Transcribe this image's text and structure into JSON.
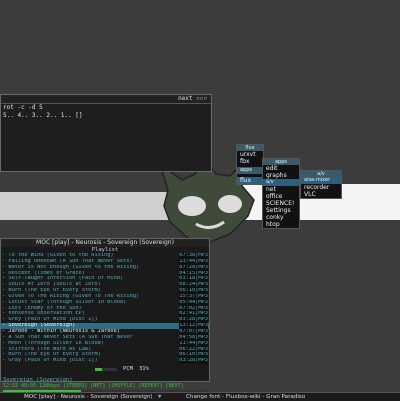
{
  "terminal": {
    "title": "next",
    "prompt_line": "rot -c -d 5",
    "countdown_line": "5.. 4.. 3.. 2.. 1.. []"
  },
  "menus": {
    "flux_title": "flux",
    "flux_items": [
      "urxvt",
      "fbx"
    ],
    "apps_title": "apps",
    "flux_sub_label": "flux",
    "apps_items": [
      "edit",
      "graphs",
      "net",
      "office",
      "SCIENCE!",
      "Settings",
      "conky",
      "htop"
    ],
    "av_title": "a/v",
    "av_items": [
      "alsa-mixer",
      "recorder",
      "VLC"
    ]
  },
  "moc": {
    "title": "MOC [play] - Neurosis - Sovereign (Sovereign)",
    "playlist_label": "Playlist",
    "tracks": [
      {
        "title": "- To the Wind (Given to the Rising)",
        "duration": "07:38",
        "fmt": "MP3"
      },
      {
        "title": "- Falling Unknown (A Sun That Never Sets)",
        "duration": "13:44",
        "fmt": "MP3"
      },
      {
        "title": "- Water is Not Enough (Given to the Rising)",
        "duration": "07:28",
        "fmt": "MP3"
      },
      {
        "title": "- Descent (Times of Grace)",
        "duration": "04:15",
        "fmt": "MP3"
      },
      {
        "title": "- Self-Taught Infection (Pain Of Mind)",
        "duration": "03:18",
        "fmt": "MP3"
      },
      {
        "title": "- Souls At Zero (Souls at Zero)",
        "duration": "08:24",
        "fmt": "MP3"
      },
      {
        "title": "- Burn (The Eye Of Every Storm)",
        "duration": "06:10",
        "fmt": "MP3"
      },
      {
        "title": "- Given To The Rising (Given To The Rising)",
        "duration": "15:37",
        "fmt": "MP3"
      },
      {
        "title": "- Locust Star (Through Silver in Blood)",
        "duration": "05:44",
        "fmt": "MP3"
      },
      {
        "title": "- Lost (Enemy of the Sun)",
        "duration": "07:02",
        "fmt": "MP3"
      },
      {
        "title": "- nonsense Observation EP)",
        "duration": "02:41",
        "fmt": "MP3"
      },
      {
        "title": "- Grey (Pain Of Mind [Disc 1])",
        "duration": "03:28",
        "fmt": "MP3"
      },
      {
        "title": "- Sovereign (Sovereign)",
        "duration": "13:12",
        "fmt": "MP3"
      },
      {
        "title": "- Jarboe - Within (Neurosis & Jarboe)",
        "duration": "07:07",
        "fmt": "MP3"
      },
      {
        "title": "- A Sun That Never Sets (A Sun That Never",
        "duration": "04:58",
        "fmt": "MP3"
      },
      {
        "title": "- Moon (Through Silver in Blood)",
        "duration": "11:44",
        "fmt": "MP3"
      },
      {
        "title": "- Stirtera (The Word As Law)",
        "duration": "06:22",
        "fmt": "MP3"
      },
      {
        "title": "- Burn (The Eye Of Every Storm)",
        "duration": "06:10",
        "fmt": "MP3"
      },
      {
        "title": "- Gray (Pain Of Mind [Disc 1])",
        "duration": "03:28",
        "fmt": "MP3"
      }
    ],
    "volume_label": "PCM",
    "volume_value": "31%",
    "now_playing": "Sovereign (Sovereign)",
    "status_line": "12:52  48:05  128kbps [STEREO]  [NET] [SHUFFLE] [REPEAT]  [NEXT]",
    "progress_fraction": 0.38
  },
  "taskbar": {
    "tasks": [
      "MOC [play] - Neurosis - Sovereign (Sovereign)",
      "Change font - Fluxbox-wiki - Gran Paradiso"
    ]
  },
  "colors": {
    "desktop": "#3c3c3c",
    "accent_cyan": "#4fb0c0",
    "highlight_row": "#2e6d86",
    "progress_green": "#3bbf3b",
    "logo_green": "#3f4a3a"
  },
  "icons": {
    "logo": "cat-skull-logo",
    "terminal_controls": "window-controls-icon"
  }
}
